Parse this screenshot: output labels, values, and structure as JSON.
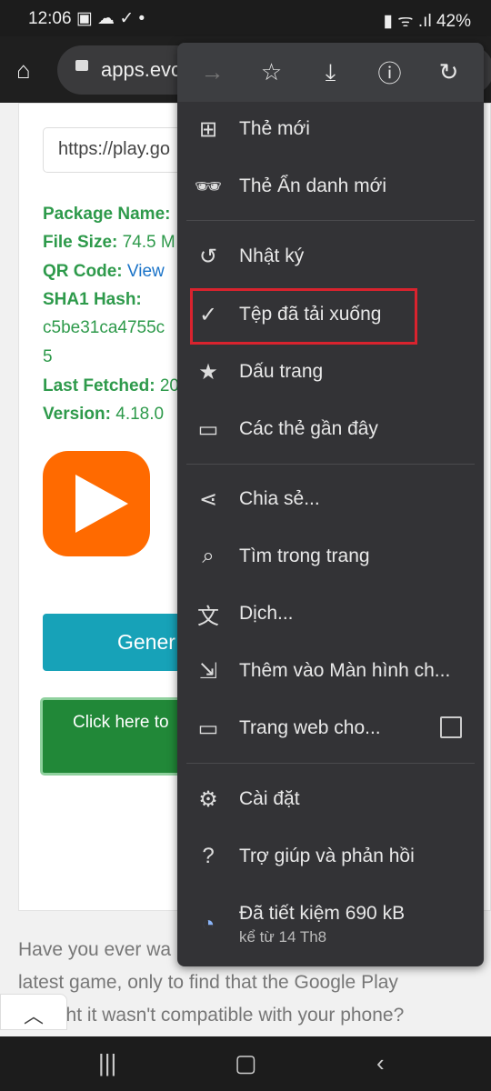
{
  "status": {
    "time": "12:06",
    "icons": [
      "image-icon",
      "cloud-icon",
      "download-done-icon",
      "dot-icon"
    ],
    "battery": "42%"
  },
  "toolbar": {
    "url": "apps.evo"
  },
  "page": {
    "input_value": "https://play.go",
    "package_label": "Package Name:",
    "filesize_label": "File Size:",
    "filesize_value": "74.5 M",
    "qr_label": "QR Code:",
    "qr_link": "View",
    "sha_label": "SHA1 Hash:",
    "sha_value": "c5be31ca4755c",
    "sha_tail": "5",
    "fetched_label": "Last Fetched:",
    "fetched_value": "20",
    "version_label": "Version:",
    "version_value": "4.18.0",
    "generate_label": "Gener",
    "download_label": "Click here to",
    "paragraph": [
      "Have you ever wa",
      "latest game, only to find that the Google Play",
      "thought it wasn't compatible with your phone?"
    ]
  },
  "menu": {
    "toolbar_icons": [
      "forward-icon",
      "star-icon",
      "download-icon",
      "info-icon",
      "refresh-icon"
    ],
    "items": [
      {
        "label": "Thẻ mới",
        "icon": "new-tab-icon"
      },
      {
        "label": "Thẻ Ẩn danh mới",
        "icon": "incognito-icon"
      },
      {
        "label": "Nhật ký",
        "icon": "history-icon"
      },
      {
        "label": "Tệp đã tải xuống",
        "icon": "downloads-icon"
      },
      {
        "label": "Dấu trang",
        "icon": "bookmark-star-icon"
      },
      {
        "label": "Các thẻ gần đây",
        "icon": "devices-icon"
      },
      {
        "label": "Chia sẻ...",
        "icon": "share-icon"
      },
      {
        "label": "Tìm trong trang",
        "icon": "find-icon"
      },
      {
        "label": "Dịch...",
        "icon": "translate-icon"
      },
      {
        "label": "Thêm vào Màn hình ch...",
        "icon": "add-home-icon"
      },
      {
        "label": "Trang web cho...",
        "icon": "desktop-icon"
      },
      {
        "label": "Cài đặt",
        "icon": "settings-icon"
      },
      {
        "label": "Trợ giúp và phản hồi",
        "icon": "help-icon"
      }
    ],
    "savings": {
      "title": "Đã tiết kiệm 690 kB",
      "subtitle": "kể từ 14 Th8",
      "color": "#8ab4f8"
    },
    "highlight_color": "#d9232e"
  }
}
